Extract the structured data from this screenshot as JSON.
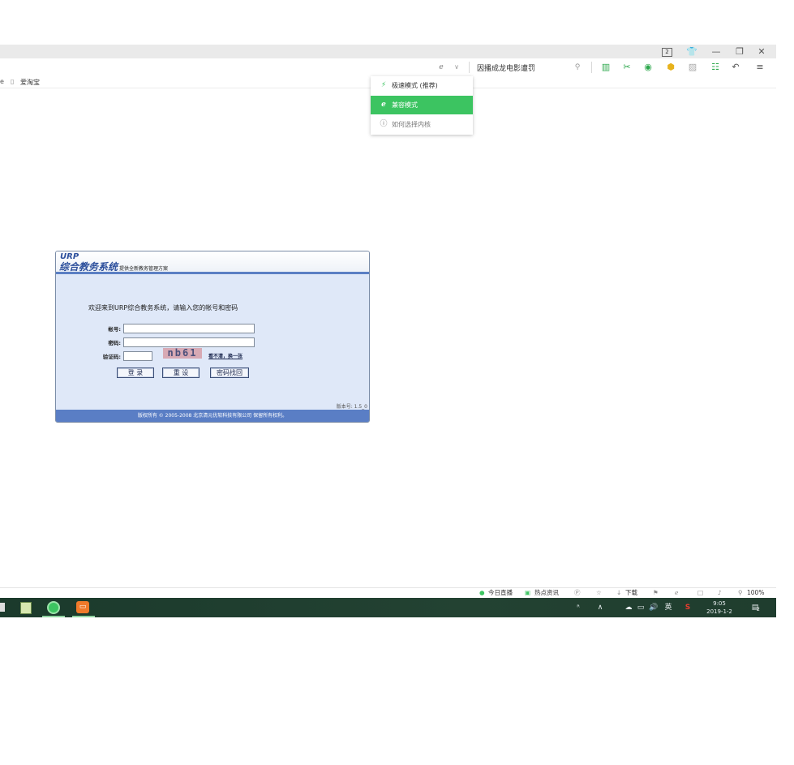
{
  "browser": {
    "tab_count": "2",
    "toolbar_search_text": "因播成龙电影遭罚",
    "favorites": {
      "partial": "e",
      "item": "爱淘宝"
    },
    "kernel_menu": [
      {
        "label": "极速模式 (推荐)",
        "icon": "lightning-icon",
        "selected": false
      },
      {
        "label": "兼容模式",
        "icon": "ie-icon",
        "selected": true
      },
      {
        "label": "如何选择内核",
        "icon": "help-icon",
        "selected": false
      }
    ],
    "accent_green": "#3cc461"
  },
  "login": {
    "brand": "URP",
    "title": "综合教务系统",
    "subtitle": "提供全新教务管理方案",
    "welcome": "欢迎来到URP综合教务系统，请输入您的帐号和密码",
    "account_label": "帐号:",
    "password_label": "密码:",
    "captcha_label": "验证码:",
    "captcha_text": "nb61",
    "captcha_refresh": "看不清，换一张",
    "login_button": "登 录",
    "reset_button": "重 设",
    "recover_button": "密码找回",
    "version": "版本号: 1.5_0",
    "footer": "版权所有 © 2005-2008 北京清元优软科技有限公司 保留所有权利。"
  },
  "statusbar": {
    "live": "今日直播",
    "news": "热点资讯",
    "download": "下载",
    "zoom": "100%"
  },
  "taskbar": {
    "ime": "英",
    "time": "9:05",
    "date": "2019-1-2",
    "notification_count": "2"
  }
}
